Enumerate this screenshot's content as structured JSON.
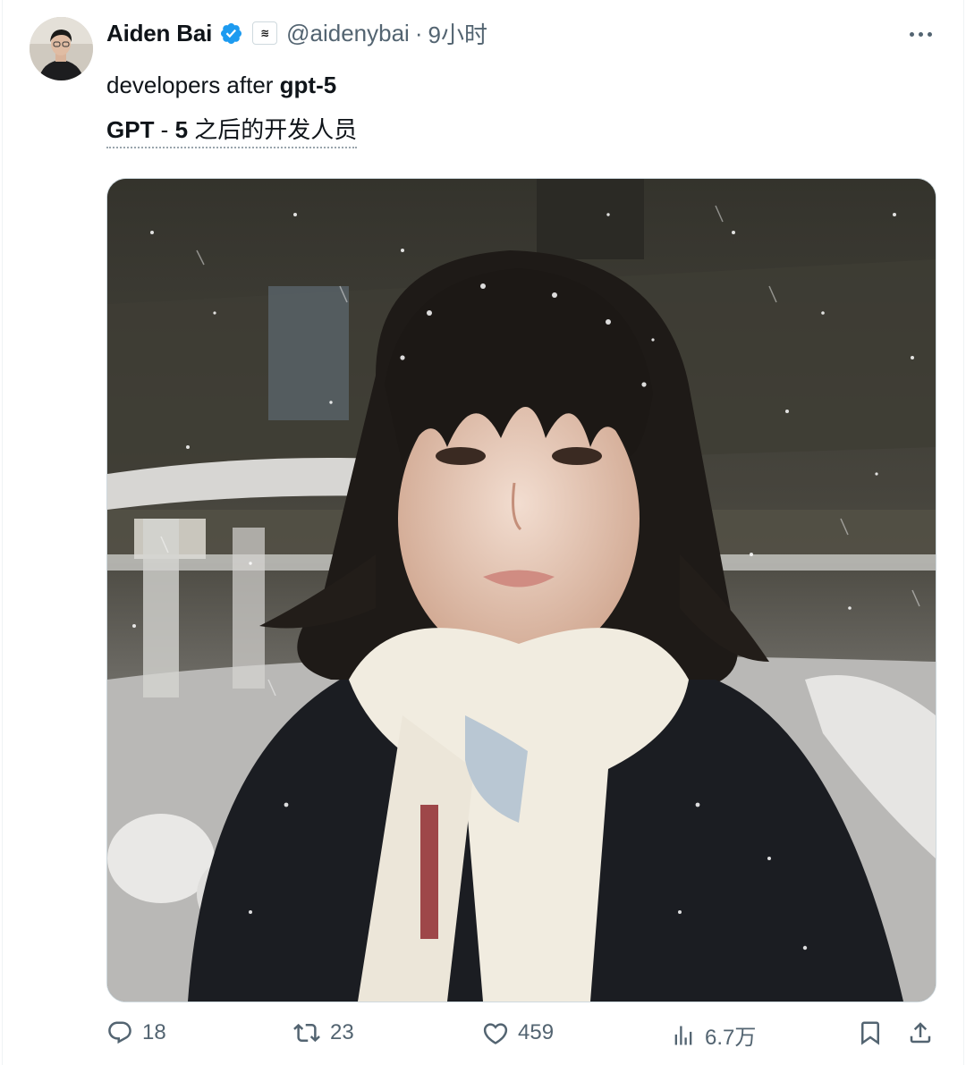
{
  "tweet": {
    "author": {
      "name": "Aiden Bai",
      "handle": "@aidenybai",
      "verified": true,
      "affiliate_badge": "≋"
    },
    "separator": "·",
    "time": "9小时",
    "text_plain": "developers after ",
    "text_bold": "gpt-5",
    "translation": {
      "part1": "GPT",
      "part2": " - ",
      "part3": "5",
      "part4": " 之后的开发人员"
    },
    "media": {
      "kind": "photo"
    }
  },
  "actions": {
    "replies": "18",
    "retweets": "23",
    "likes": "459",
    "views": "6.7万"
  },
  "colors": {
    "text": "#0f1419",
    "secondary": "#536471",
    "verified": "#1d9bf0",
    "border": "#cfd9de"
  },
  "icons": [
    "more-icon",
    "verified-badge-icon",
    "reply-icon",
    "retweet-icon",
    "like-icon",
    "views-icon",
    "bookmark-icon",
    "share-icon"
  ]
}
